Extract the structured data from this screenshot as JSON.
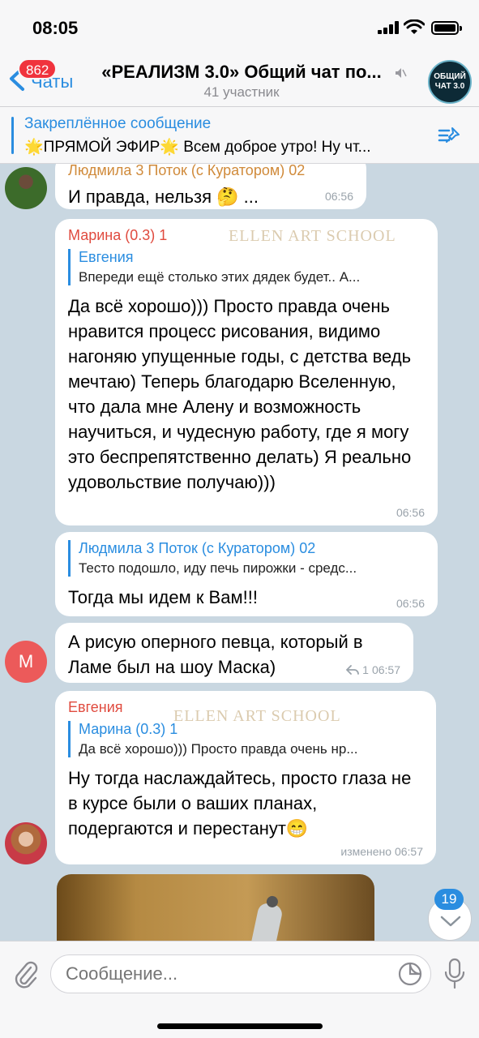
{
  "status_bar": {
    "time": "08:05"
  },
  "header": {
    "back_label": "Чаты",
    "unread_badge": "862",
    "title": "«РЕАЛИЗМ 3.0» Общий чат по...",
    "subtitle": "41 участник",
    "group_avatar_text": [
      "ОБЩИЙ",
      "ЧАТ 3.0"
    ]
  },
  "pinned": {
    "title": "Закреплённое сообщение",
    "text": "🌟ПРЯМОЙ ЭФИР🌟 Всем доброе утро!  Ну чт..."
  },
  "watermark": "ELLEN ART SCHOOL",
  "messages": [
    {
      "sender": "Людмила 3 Поток (с Куратором) 02",
      "text": "И правда, нельзя 🤔 ...",
      "time": "06:56"
    },
    {
      "sender": "Марина (0.3) 1",
      "sender_color": "#e04b3f",
      "reply_name": "Евгения",
      "reply_text": "Впереди ещё столько этих дядек будет.. А...",
      "text": "Да всё хорошо))) Просто правда очень нравится процесс рисования, видимо нагоняю упущенные годы, с детства ведь мечтаю) Теперь благодарю Вселенную, что дала мне Алену и возможность научиться, и чудесную работу, где я могу это беспрепятственно делать) Я реально удовольствие получаю)))",
      "time": "06:56"
    },
    {
      "reply_name": "Людмила 3 Поток (с Куратором) 02",
      "reply_text": "Тесто подошло, иду печь пирожки - средс...",
      "text": "Тогда мы идем к Вам!!!",
      "time": "06:56"
    },
    {
      "avatar_letter": "M",
      "avatar_color": "#ec5a5a",
      "text": "А рисую оперного певца, который в Ламе был на шоу Маска)",
      "replies_count": "1",
      "time": "06:57"
    },
    {
      "sender": "Евгения",
      "sender_color": "#e04b3f",
      "reply_name": "Марина (0.3) 1",
      "reply_text": "Да всё хорошо))) Просто правда очень нр...",
      "text": "Ну тогда наслаждайтесь, просто глаза не в курсе были о ваших планах, подергаются и перестанут😁",
      "time": "изменено 06:57"
    }
  ],
  "scroll_badge": "19",
  "input": {
    "placeholder": "Сообщение..."
  },
  "colors": {
    "accent": "#2a8de0",
    "badge": "#f0333d",
    "chat_bg": "#c9d7e1"
  }
}
